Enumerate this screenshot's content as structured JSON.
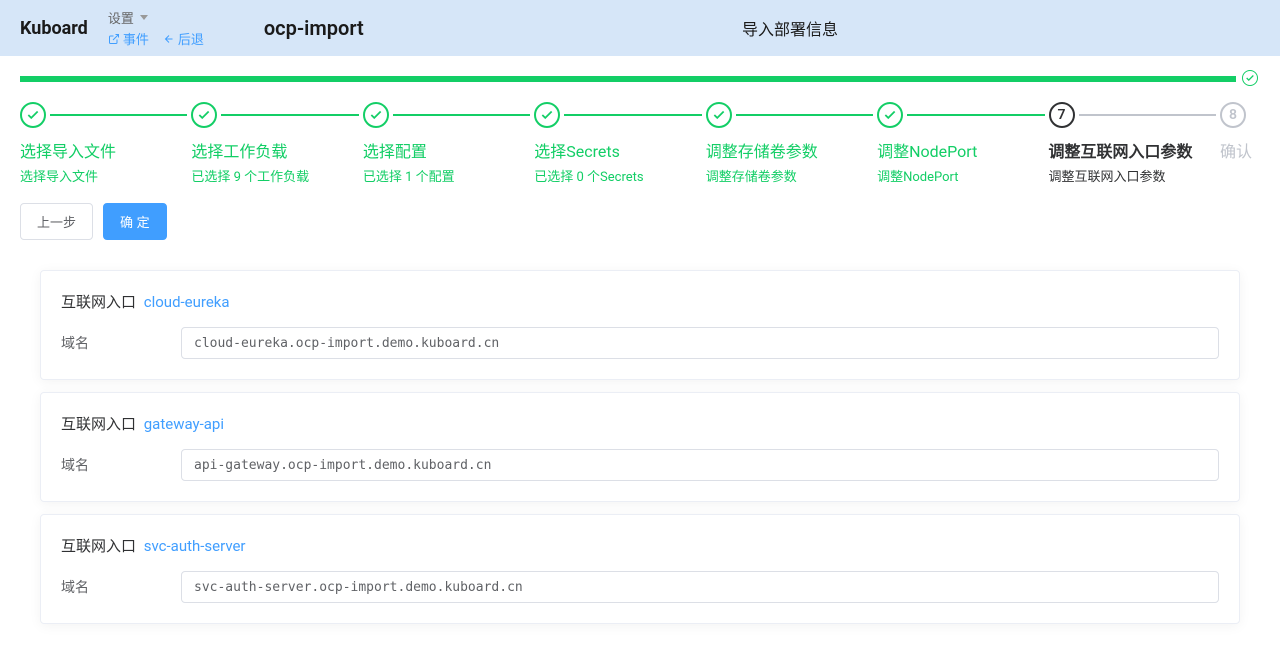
{
  "header": {
    "logo": "Kuboard",
    "settings_label": "设置",
    "events_label": "事件",
    "back_label": "后退",
    "namespace": "ocp-import",
    "page_title": "导入部署信息"
  },
  "steps": [
    {
      "title": "选择导入文件",
      "desc": "选择导入文件",
      "status": "done"
    },
    {
      "title": "选择工作负载",
      "desc": "已选择 9 个工作负载",
      "status": "done"
    },
    {
      "title": "选择配置",
      "desc": "已选择 1 个配置",
      "status": "done"
    },
    {
      "title": "选择Secrets",
      "desc": "已选择 0 个Secrets",
      "status": "done"
    },
    {
      "title": "调整存储卷参数",
      "desc": "调整存储卷参数",
      "status": "done"
    },
    {
      "title": "调整NodePort",
      "desc": "调整NodePort",
      "status": "done"
    },
    {
      "title": "调整互联网入口参数",
      "desc": "调整互联网入口参数",
      "status": "current",
      "num": "7"
    },
    {
      "title": "确认",
      "desc": "",
      "status": "pending",
      "num": "8"
    }
  ],
  "actions": {
    "prev_label": "上一步",
    "confirm_label": "确 定"
  },
  "ingress_label": "互联网入口",
  "domain_label": "域名",
  "ingresses": [
    {
      "name": "cloud-eureka",
      "domain": "cloud-eureka.ocp-import.demo.kuboard.cn"
    },
    {
      "name": "gateway-api",
      "domain": "api-gateway.ocp-import.demo.kuboard.cn"
    },
    {
      "name": "svc-auth-server",
      "domain": "svc-auth-server.ocp-import.demo.kuboard.cn"
    }
  ]
}
